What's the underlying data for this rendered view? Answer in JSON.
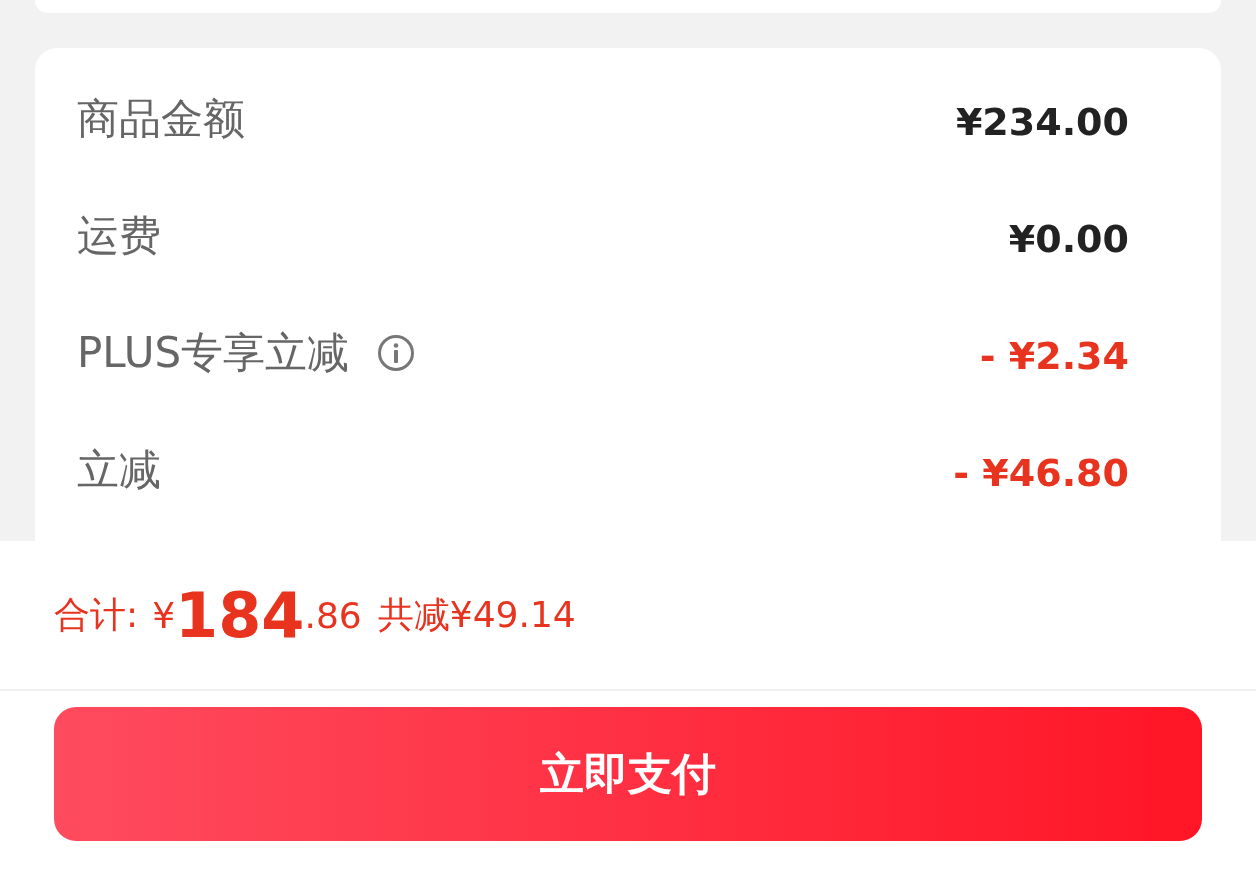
{
  "summary": {
    "rows": [
      {
        "label": "商品金额",
        "value": "¥234.00",
        "kind": "normal",
        "info": false
      },
      {
        "label": "运费",
        "value": "¥0.00",
        "kind": "normal",
        "info": false
      },
      {
        "label": "PLUS专享立减",
        "value": "- ¥2.34",
        "kind": "discount",
        "info": true
      },
      {
        "label": "立减",
        "value": "- ¥46.80",
        "kind": "discount",
        "info": false
      }
    ]
  },
  "total": {
    "label": "合计:",
    "currency": "¥",
    "integer": "184",
    "decimal": ".86",
    "saving": "共减¥49.14"
  },
  "pay_button": {
    "label": "立即支付"
  }
}
